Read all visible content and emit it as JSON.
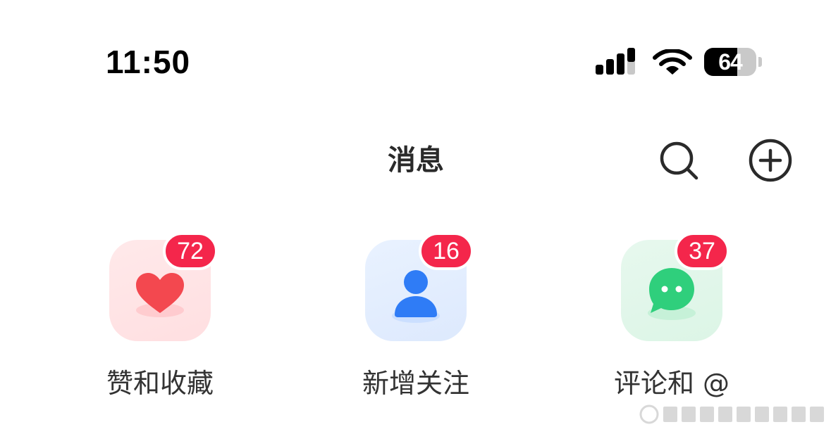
{
  "status_bar": {
    "time": "11:50",
    "battery_level": "64",
    "battery_fraction": 0.64,
    "icons": [
      "signal-icon",
      "wifi-icon",
      "battery-icon"
    ]
  },
  "header": {
    "title": "消息",
    "actions": [
      {
        "name": "search",
        "icon": "search-icon"
      },
      {
        "name": "add",
        "icon": "plus-circle-icon"
      }
    ]
  },
  "shortcuts": [
    {
      "label": "赞和收藏",
      "badge": "72",
      "icon": "heart-icon",
      "accent": "#f3484f"
    },
    {
      "label": "新增关注",
      "badge": "16",
      "icon": "person-icon",
      "accent": "#2f7cf6"
    },
    {
      "label": "评论和 @",
      "badge": "37",
      "icon": "chat-bubble-icon",
      "accent": "#2fcf7c"
    }
  ],
  "colors": {
    "badge": "#f4264b",
    "text": "#333333"
  }
}
